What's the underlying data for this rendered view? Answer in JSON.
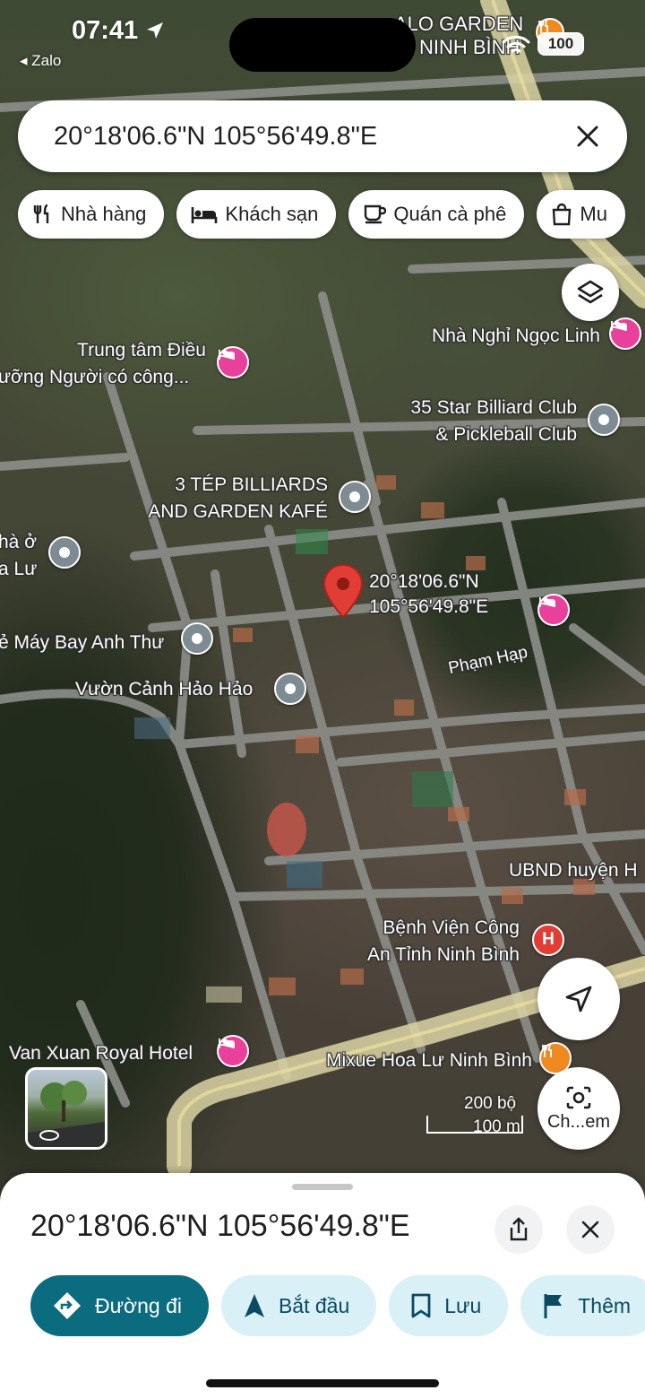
{
  "status_bar": {
    "time": "07:41",
    "back_app": "◂ Zalo",
    "battery": "100"
  },
  "search": {
    "value": "20°18'06.6\"N 105°56'49.8\"E"
  },
  "chips": [
    {
      "label": "Nhà hàng",
      "icon": "fork-knife-icon"
    },
    {
      "label": "Khách sạn",
      "icon": "bed-icon"
    },
    {
      "label": "Quán cà phê",
      "icon": "coffee-cup-icon"
    },
    {
      "label": "Mu",
      "icon": "shopping-bag-icon"
    }
  ],
  "map": {
    "labels": {
      "alo_garden": "ALO GARDEN",
      "ninh_binh": "NINH BÌNH",
      "nha_nghi": "Nhà Nghỉ Ngọc Linh",
      "trung_tam_1": "Trung tâm Điều",
      "trung_tam_2": "ưỡng Người có công...",
      "billiard_1": "35 Star Billiard Club",
      "billiard_2": "& Pickleball Club",
      "tep_1": "3 TÉP BILLIARDS",
      "tep_2": "AND GARDEN KAFÉ",
      "nha_o_1": "hà ở",
      "nha_o_2": "a Lư",
      "coord_1": "20°18'06.6\"N",
      "coord_2": "105°56'49.8\"E",
      "may_bay": "ẻ Máy Bay Anh Thư",
      "pham_hap": "Phạm Hạp",
      "vuon_canh": "Vườn Cảnh Hảo Hảo",
      "ubnd": "UBND huyện H",
      "benh_vien_1": "Bệnh Viện Công",
      "benh_vien_2": "An Tỉnh Ninh Bình",
      "van_xuan": "Van Xuan Royal Hotel",
      "mixue": "Mixue Hoa Lư Ninh Bình"
    },
    "scale": {
      "imperial": "200 bộ",
      "metric": "100 m"
    },
    "camera_label": "Ch...em",
    "hospital_letter": "H"
  },
  "sheet": {
    "title": "20°18'06.6\"N 105°56'49.8\"E",
    "actions": [
      {
        "label": "Đường đi",
        "icon": "directions-icon"
      },
      {
        "label": "Bắt đầu",
        "icon": "navigation-arrow-icon"
      },
      {
        "label": "Lưu",
        "icon": "bookmark-icon"
      },
      {
        "label": "Thêm",
        "icon": "flag-icon"
      }
    ]
  },
  "colors": {
    "primary_action": "#0b6b7f",
    "action_bg": "#d9f0f7",
    "pin_red": "#e13d35",
    "lodging_pink": "#e8409b",
    "food_orange": "#f08a20"
  }
}
